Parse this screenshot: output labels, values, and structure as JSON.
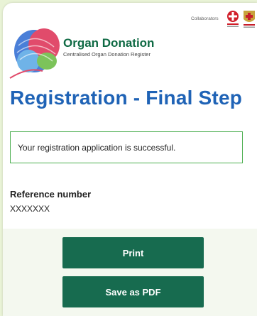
{
  "brand": {
    "title": "Organ Donation",
    "subtitle": "Centralised Organ Donation Register"
  },
  "collaborators": {
    "label": "Collaborators",
    "emblems": [
      "department-of-health-emblem",
      "hong-kong-red-cross-emblem"
    ]
  },
  "page": {
    "title": "Registration - Final Step"
  },
  "status": {
    "message": "Your registration application is successful."
  },
  "reference": {
    "label": "Reference number",
    "value": "XXXXXXX"
  },
  "actions": {
    "print_label": "Print",
    "save_pdf_label": "Save as PDF"
  },
  "colors": {
    "brand_green": "#0f6a44",
    "title_blue": "#1f63b6",
    "button_green": "#176b4f",
    "success_border": "#4caf50",
    "page_background": "#e9f3d6"
  }
}
